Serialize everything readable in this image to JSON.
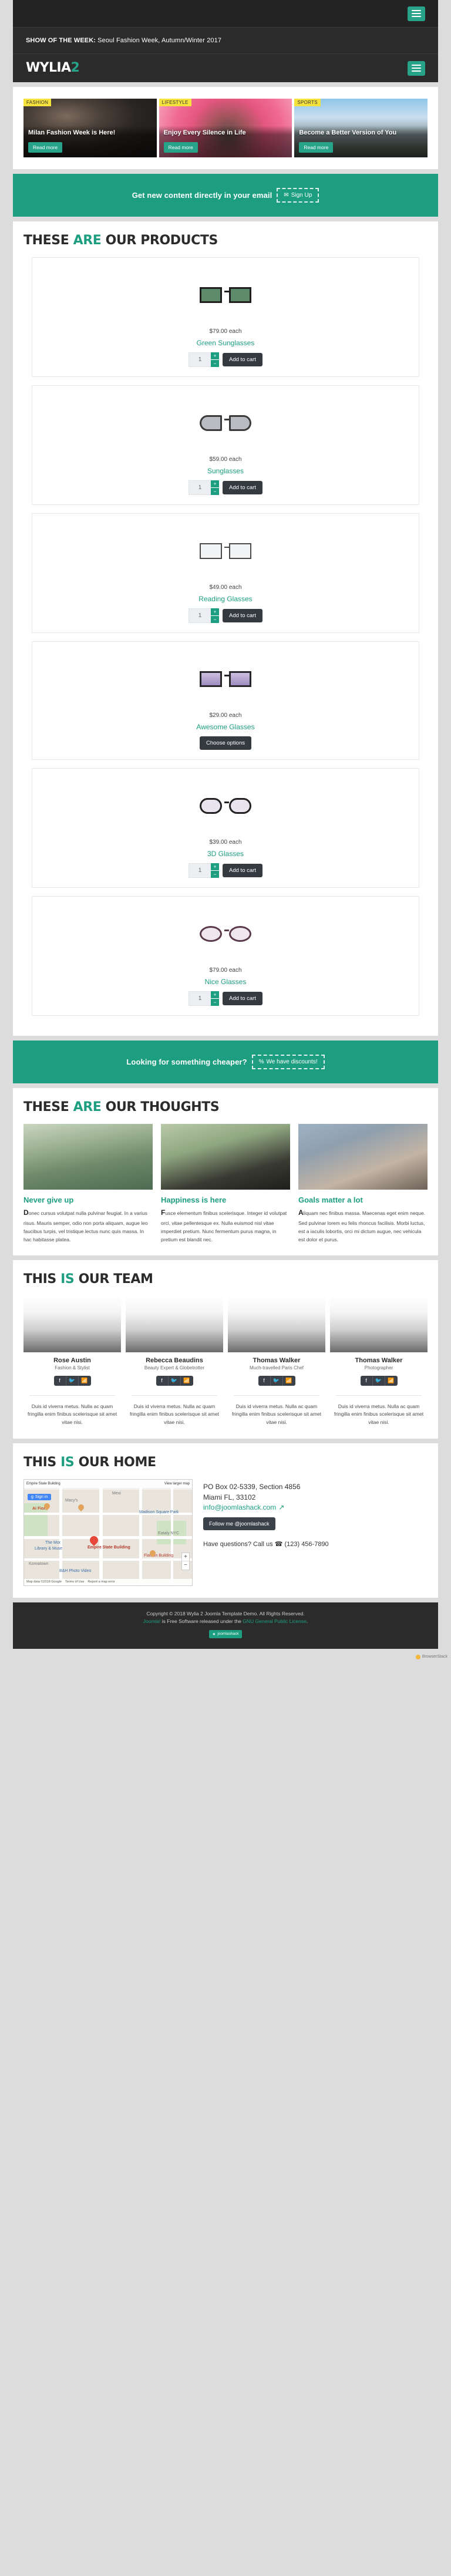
{
  "header": {
    "menu_icon": "hamburger-icon",
    "show_of_the_week_label": "SHOW OF THE WEEK:",
    "show_of_the_week_value": " Seoul Fashion Week, Autumn/Winter 2017",
    "logo_main": "WYLIA",
    "logo_accent": "2"
  },
  "banners": [
    {
      "category": "FASHION",
      "title": "Milan Fashion Week is Here!",
      "button": "Read more"
    },
    {
      "category": "LIFESTYLE",
      "title": "Enjoy Every Silence in Life",
      "button": "Read more"
    },
    {
      "category": "SPORTS",
      "title": "Become a Better Version of You",
      "button": "Read more"
    }
  ],
  "cta_newsletter": {
    "text": "Get new content directly in your email",
    "button": "Sign Up",
    "icon": "newsletter-icon"
  },
  "products_section": {
    "heading_pre": "THESE ",
    "heading_hl": "ARE",
    "heading_post": " OUR PRODUCTS",
    "items": [
      {
        "price": "$79.00 each",
        "name": "Green Sunglasses",
        "qty": "1",
        "button": "Add to cart",
        "lens": "#5d8a6a",
        "frame": "#1f1f1f"
      },
      {
        "price": "$59.00 each",
        "name": "Sunglasses",
        "qty": "1",
        "button": "Add to cart",
        "lens": "#b9bcc0",
        "frame": "#3a3a3a"
      },
      {
        "price": "$49.00 each",
        "name": "Reading Glasses",
        "qty": "1",
        "button": "Add to cart",
        "lens": "#f2f4f6",
        "frame": "#4a4a4a"
      },
      {
        "price": "$29.00 each",
        "name": "Awesome Glasses",
        "qty": "",
        "button": "Choose options",
        "lens": "#b9a8d4",
        "frame": "#26262b"
      },
      {
        "price": "$39.00 each",
        "name": "3D Glasses",
        "qty": "1",
        "button": "Add to cart",
        "lens": "#e9e4ee",
        "frame": "#222222"
      },
      {
        "price": "$79.00 each",
        "name": "Nice Glasses",
        "qty": "1",
        "button": "Add to cart",
        "lens": "#efe6ee",
        "frame": "#5a3a4a"
      }
    ]
  },
  "cta_discounts": {
    "text": "Looking for something cheaper?",
    "button": "We have discounts!",
    "icon": "percent-icon"
  },
  "thoughts_section": {
    "heading_pre": "THESE ",
    "heading_hl": "ARE",
    "heading_post": " OUR THOUGHTS",
    "items": [
      {
        "title": "Never give up",
        "dropcap": "D",
        "body": "onec cursus volutpat nulla pulvinar feugiat. In a varius risus. Mauris semper, odio non porta aliquam, augue leo faucibus turpis, vel tristique lectus nunc quis massa. In hac habitasse platea."
      },
      {
        "title": "Happiness is here",
        "dropcap": "F",
        "body": "usce elementum finibus scelerisque. Integer id volutpat orci, vitae pellentesque ex. Nulla euismod nisl vitae imperdiet pretium. Nunc fermentum purus magna, in pretium est blandit nec."
      },
      {
        "title": "Goals matter a lot",
        "dropcap": "A",
        "body": "liquam nec finibus massa. Maecenas eget enim neque. Sed pulvinar lorem eu felis rhoncus facilisis. Morbi luctus, est a iaculis lobortis, orci mi dictum augue, nec vehicula est dolor et purus."
      }
    ]
  },
  "team_section": {
    "heading_pre": "THIS ",
    "heading_hl": "IS",
    "heading_post": " OUR TEAM",
    "social_icons": [
      "facebook-icon",
      "twitter-icon",
      "rss-icon"
    ],
    "members": [
      {
        "name": "Rose Austin",
        "role": "Fashion & Stylist",
        "desc": "Duis id viverra metus. Nulla ac quam fringilla enim finibus scelerisque sit amet vitae nisi."
      },
      {
        "name": "Rebecca Beaudins",
        "role": "Beauty Expert & Globetrotter",
        "desc": "Duis id viverra metus. Nulla ac quam fringilla enim finibus scelerisque sit amet vitae nisi."
      },
      {
        "name": "Thomas Walker",
        "role": "Much-travelled Paris Chef",
        "desc": "Duis id viverra metus. Nulla ac quam fringilla enim finibus scelerisque sit amet vitae nisi."
      },
      {
        "name": "Thomas Walker",
        "role": "Photographer",
        "desc": "Duis id viverra metus. Nulla ac quam fringilla enim finibus scelerisque sit amet vitae nisi."
      }
    ]
  },
  "home_section": {
    "heading_pre": "THIS ",
    "heading_hl": "IS",
    "heading_post": " OUR HOME",
    "map": {
      "title": "Empire State Building",
      "view_larger": "View larger map",
      "sign_in": "Sign in",
      "labels": [
        "Mexi",
        "Ai Fiori",
        "The Mor",
        "Library & Muse",
        "Empire State Building",
        "Koreatown",
        "B&H Photo Video",
        "Madison Square Park",
        "Flatiron Building",
        "Eataly NYC",
        "Macy's"
      ],
      "attribution": "Map data ©2018 Google",
      "terms": "Terms of Use",
      "report": "Report a map error",
      "zoom_in": "+",
      "zoom_out": "−"
    },
    "address_line1": "PO Box 02-5339, Section 4856",
    "address_line2": "Miami FL, 33102",
    "email": "info@joomlashack.com",
    "email_icon": "external-link-icon",
    "follow_button": "Follow me @joomlashack",
    "call_label": "Have questions? Call us ",
    "call_icon": "phone-icon",
    "call_number": "(123) 456-7890"
  },
  "footer": {
    "copyright": "Copyright © 2018 Wylia 2 Joomla Template Demo. All Rights Reserved.",
    "license_pre": "Joomla!",
    "license_mid": " is Free Software released under the ",
    "license_link": "GNU General Public License",
    "license_post": ".",
    "badge": "joomlashack"
  },
  "watermark": {
    "text": "BrowserStack"
  },
  "colors": {
    "accent_green": "#1d9e81",
    "teal_button": "#27a38a",
    "dark_bar": "#2b2b2b",
    "darker_bar": "#232323",
    "dark_button": "#343a40",
    "category_yellow": "#f5e23c",
    "page_bg": "#dcdcdc"
  }
}
